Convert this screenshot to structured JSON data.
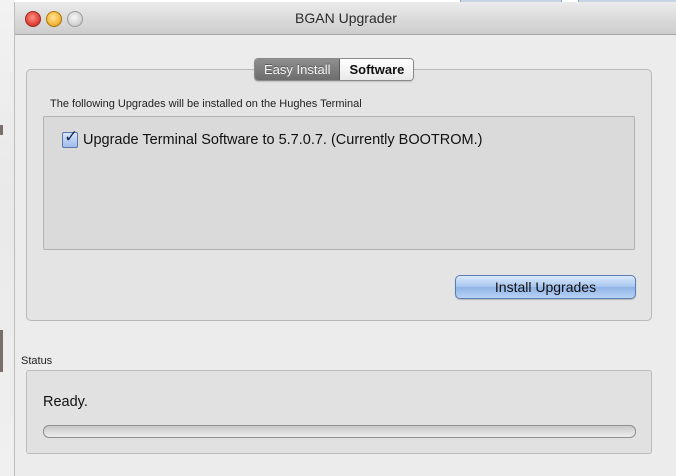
{
  "window": {
    "title": "BGAN Upgrader"
  },
  "tabs": [
    {
      "label": "Easy Install",
      "selected": true
    },
    {
      "label": "Software",
      "selected": false
    }
  ],
  "upgrades": {
    "description": "The following Upgrades will be installed on the Hughes Terminal",
    "items": [
      {
        "label": "Upgrade Terminal Software to 5.7.0.7. (Currently BOOTROM.)",
        "checked": true
      }
    ]
  },
  "buttons": {
    "install_label": "Install Upgrades"
  },
  "status": {
    "section_label": "Status",
    "text": "Ready.",
    "progress": 0
  },
  "colors": {
    "window_bg": "#ececec",
    "accent_button": "#a7c5ee",
    "segment_active": "#6d6d6d",
    "traffic_close": "#e0443a",
    "traffic_minimize": "#f4b73a",
    "traffic_zoom_disabled": "#cfcfcf"
  },
  "icons": {
    "close": "close-icon",
    "minimize": "minimize-icon",
    "zoom": "zoom-icon",
    "checkmark": "checkmark-icon"
  }
}
